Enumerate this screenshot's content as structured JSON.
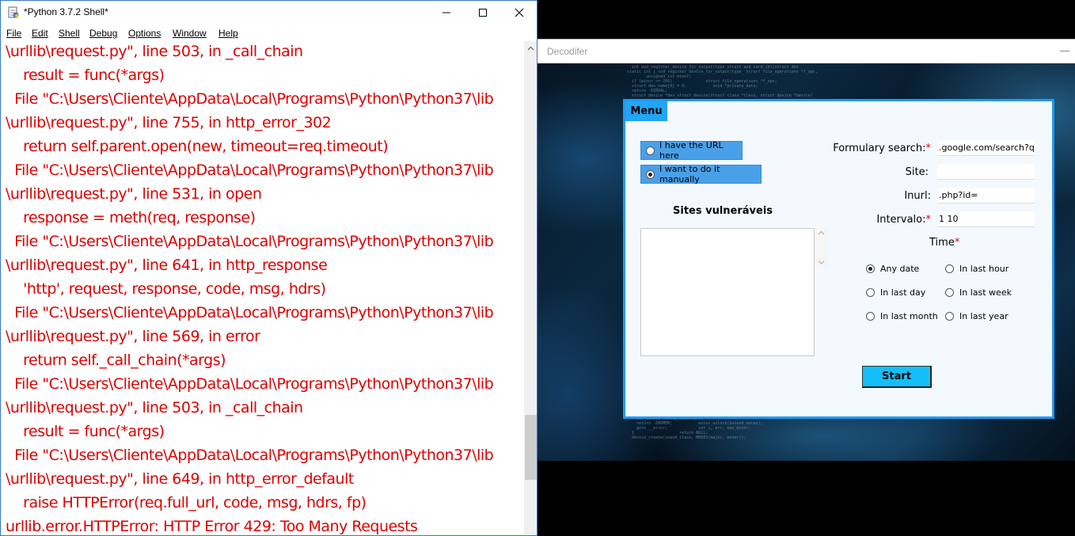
{
  "shell": {
    "title": "*Python 3.7.2 Shell*",
    "menu": [
      "File",
      "Edit",
      "Shell",
      "Debug",
      "Options",
      "Window",
      "Help"
    ],
    "lines": [
      "\\urllib\\request.py\", line 503, in _call_chain",
      "    result = func(*args)",
      "  File \"C:\\Users\\Cliente\\AppData\\Local\\Programs\\Python\\Python37\\lib",
      "\\urllib\\request.py\", line 755, in http_error_302",
      "    return self.parent.open(new, timeout=req.timeout)",
      "  File \"C:\\Users\\Cliente\\AppData\\Local\\Programs\\Python\\Python37\\lib",
      "\\urllib\\request.py\", line 531, in open",
      "    response = meth(req, response)",
      "  File \"C:\\Users\\Cliente\\AppData\\Local\\Programs\\Python\\Python37\\lib",
      "\\urllib\\request.py\", line 641, in http_response",
      "    'http', request, response, code, msg, hdrs)",
      "  File \"C:\\Users\\Cliente\\AppData\\Local\\Programs\\Python\\Python37\\lib",
      "\\urllib\\request.py\", line 569, in error",
      "    return self._call_chain(*args)",
      "  File \"C:\\Users\\Cliente\\AppData\\Local\\Programs\\Python\\Python37\\lib",
      "\\urllib\\request.py\", line 503, in _call_chain",
      "    result = func(*args)",
      "  File \"C:\\Users\\Cliente\\AppData\\Local\\Programs\\Python\\Python37\\lib",
      "\\urllib\\request.py\", line 649, in http_error_default",
      "    raise HTTPError(req.full_url, code, msg, hdrs, fp)",
      "urllib.error.HTTPError: HTTP Error 429: Too Many Requests"
    ],
    "text_color": "#dd0000"
  },
  "decoder": {
    "title": "Decodifer",
    "menu_tab": "Menu",
    "mode_options": [
      {
        "label": "I have the URL here",
        "selected": false
      },
      {
        "label": "I want to do it manually",
        "selected": true
      }
    ],
    "sites_title": "Sites vulneráveis",
    "form": {
      "formulary_label": "Formulary search:",
      "formulary_value": ".google.com/search?q=",
      "site_label": "Site:",
      "site_value": "",
      "inurl_label": "Inurl:",
      "inurl_value": ".php?id=",
      "intervalo_label": "Intervalo:",
      "intervalo_value": "1 10",
      "required_mark": "*"
    },
    "time": {
      "label": "Time",
      "options": [
        {
          "label": "Any date",
          "selected": true
        },
        {
          "label": "In last hour",
          "selected": false
        },
        {
          "label": "In last day",
          "selected": false
        },
        {
          "label": "In last week",
          "selected": false
        },
        {
          "label": "In last month",
          "selected": false
        },
        {
          "label": "In last year",
          "selected": false
        }
      ]
    },
    "start_label": "Start",
    "accent_color": "#1f9bf0",
    "button_color": "#14bff8"
  }
}
